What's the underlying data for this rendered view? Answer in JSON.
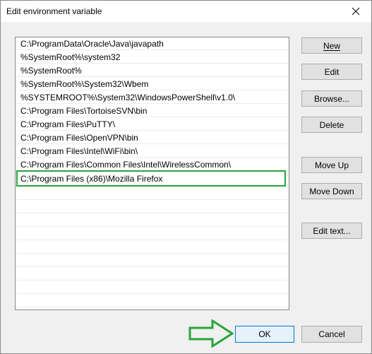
{
  "window": {
    "title": "Edit environment variable"
  },
  "list": {
    "items": [
      "C:\\ProgramData\\Oracle\\Java\\javapath",
      "%SystemRoot%\\system32",
      "%SystemRoot%",
      "%SystemRoot%\\System32\\Wbem",
      "%SYSTEMROOT%\\System32\\WindowsPowerShell\\v1.0\\",
      "C:\\Program Files\\TortoiseSVN\\bin",
      "C:\\Program Files\\PuTTY\\",
      "C:\\Program Files\\OpenVPN\\bin",
      "C:\\Program Files\\Intel\\WiFi\\bin\\",
      "C:\\Program Files\\Common Files\\Intel\\WirelessCommon\\",
      "C:\\Program Files (x86)\\Mozilla Firefox"
    ]
  },
  "buttons": {
    "new": "New",
    "edit": "Edit",
    "browse": "Browse...",
    "delete": "Delete",
    "move_up": "Move Up",
    "move_down": "Move Down",
    "edit_text": "Edit text...",
    "ok": "OK",
    "cancel": "Cancel"
  },
  "colors": {
    "highlight_border": "#2aa43c",
    "arrow_stroke": "#2aa43c",
    "ok_border": "#0078d7"
  },
  "icons": {
    "close": "close-icon",
    "arrow": "arrow-right-icon"
  }
}
